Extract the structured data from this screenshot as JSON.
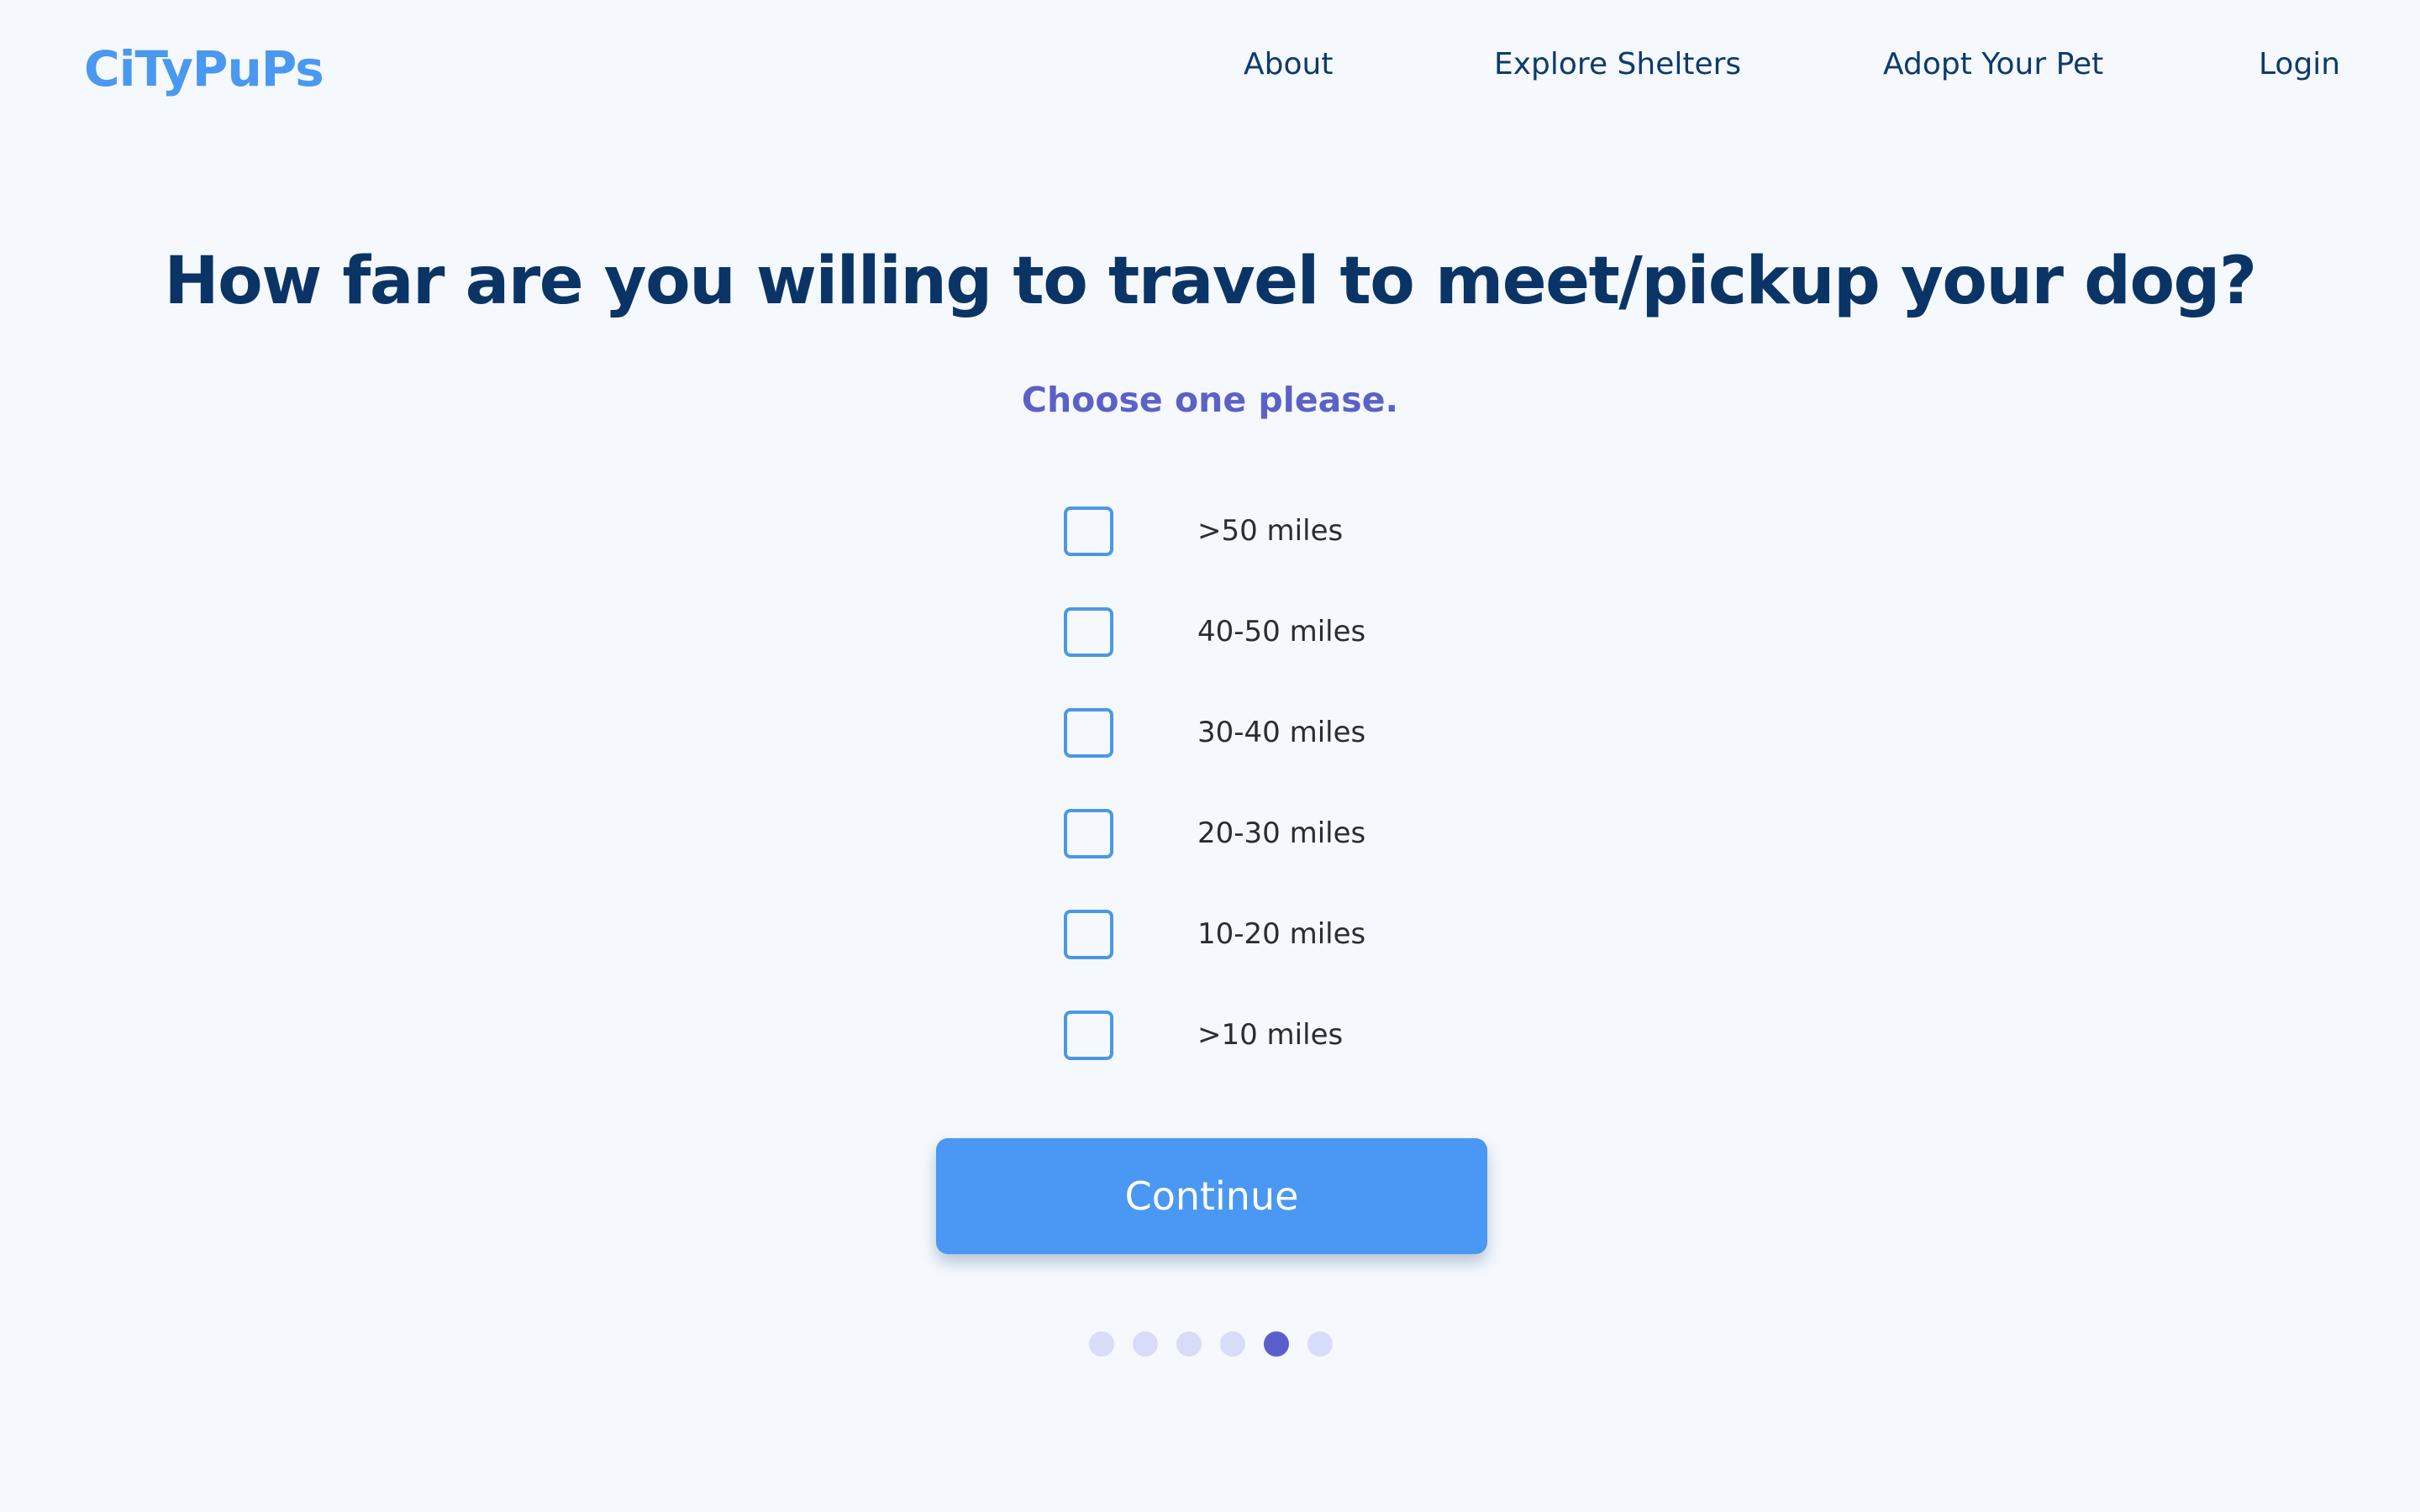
{
  "header": {
    "logo": "CiTyPuPs",
    "nav": {
      "about": "About",
      "explore_shelters": "Explore Shelters",
      "adopt": "Adopt Your Pet",
      "login": "Login"
    }
  },
  "main": {
    "question": "How far are you willing to travel to meet/pickup your dog?",
    "subtitle": "Choose one please.",
    "options": [
      {
        "label": ">50 miles",
        "checked": false
      },
      {
        "label": "40-50 miles",
        "checked": false
      },
      {
        "label": "30-40 miles",
        "checked": false
      },
      {
        "label": "20-30 miles",
        "checked": false
      },
      {
        "label": "10-20 miles",
        "checked": false
      },
      {
        "label": ">10 miles",
        "checked": false
      }
    ],
    "continue_label": "Continue"
  },
  "pagination": {
    "total_steps": 6,
    "current_step": 5
  },
  "colors": {
    "brand": "#4a98f0",
    "heading": "#0b3466",
    "accent": "#5b61c7",
    "button": "#4a98f3",
    "background": "#f5f9fd"
  }
}
